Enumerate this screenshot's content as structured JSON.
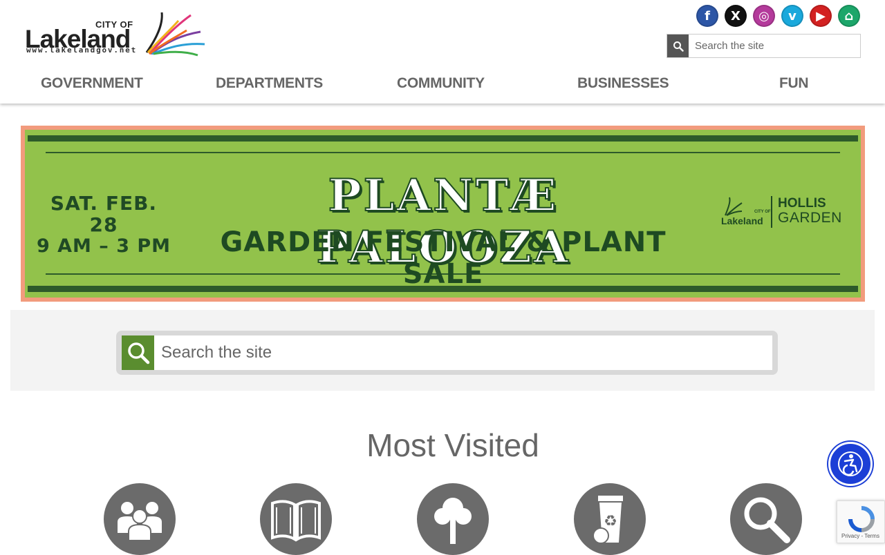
{
  "logo": {
    "city_of": "CITY OF",
    "name": "Lakeland",
    "url": "www.lakelandgov.net"
  },
  "social": [
    {
      "name": "facebook",
      "glyph": "f",
      "color": "#2d56a6"
    },
    {
      "name": "x",
      "glyph": "X",
      "color": "#111111"
    },
    {
      "name": "instagram",
      "glyph": "◎",
      "color": "#b43a9b"
    },
    {
      "name": "vimeo",
      "glyph": "v",
      "color": "#1aa9dc"
    },
    {
      "name": "youtube",
      "glyph": "▶",
      "color": "#d32121"
    },
    {
      "name": "nextdoor",
      "glyph": "⌂",
      "color": "#1ca66a"
    }
  ],
  "header_search": {
    "placeholder": "Search the site"
  },
  "nav": [
    {
      "label": "GOVERNMENT"
    },
    {
      "label": "DEPARTMENTS"
    },
    {
      "label": "COMMUNITY"
    },
    {
      "label": "BUSINESSES"
    },
    {
      "label": "FUN"
    }
  ],
  "banner": {
    "date_line1": "SAT. FEB. 28",
    "date_line2": "9 AM – 3 PM",
    "title": "PLANTÆ PALOOZA",
    "subtitle": "GARDEN FESTIVAL & PLANT SALE",
    "partner_city_of": "CITY OF",
    "partner_lakeland": "Lakeland",
    "partner_hollis": "HOLLIS",
    "partner_garden": "GARDEN"
  },
  "main_search": {
    "placeholder": "Search the site"
  },
  "most_visited": {
    "title": "Most Visited",
    "items": [
      {
        "icon": "people-icon"
      },
      {
        "icon": "book-icon"
      },
      {
        "icon": "tree-icon"
      },
      {
        "icon": "recycle-bin-icon"
      },
      {
        "icon": "magnifier-icon"
      }
    ]
  },
  "recaptcha": {
    "text": "Privacy - Terms"
  },
  "colors": {
    "banner_green": "#92c24b",
    "banner_border": "#f29b7d",
    "search_green": "#5a8d2f",
    "accessibility_blue": "#1c3fd6"
  }
}
